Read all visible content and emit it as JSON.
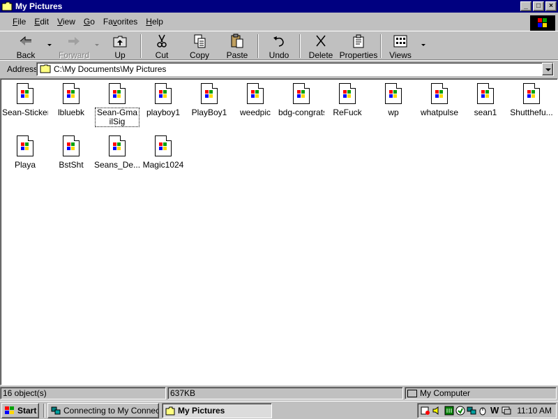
{
  "window": {
    "title": "My Pictures",
    "controls": {
      "minimize": "_",
      "maximize": "□",
      "close": "×"
    }
  },
  "menu": {
    "items": [
      {
        "key": "F",
        "rest": "ile"
      },
      {
        "key": "E",
        "rest": "dit"
      },
      {
        "key": "V",
        "rest": "iew"
      },
      {
        "key": "G",
        "rest": "o"
      },
      {
        "key": "",
        "rest": "Fa",
        "key2": "v",
        "rest2": "orites"
      },
      {
        "key": "H",
        "rest": "elp"
      }
    ]
  },
  "toolbar": {
    "back": "Back",
    "forward": "Forward",
    "up": "Up",
    "cut": "Cut",
    "copy": "Copy",
    "paste": "Paste",
    "undo": "Undo",
    "delete": "Delete",
    "properties": "Properties",
    "views": "Views"
  },
  "address": {
    "label": "Address",
    "value": "C:\\My Documents\\My Pictures"
  },
  "files": [
    {
      "name": "Sean-Sticker"
    },
    {
      "name": "lbluebk"
    },
    {
      "name": "Sean-GmailSig",
      "selected": true
    },
    {
      "name": "playboy1"
    },
    {
      "name": "PlayBoy1"
    },
    {
      "name": "weedpic"
    },
    {
      "name": "bdg-congrats"
    },
    {
      "name": "ReFuck"
    },
    {
      "name": "wp"
    },
    {
      "name": "whatpulse"
    },
    {
      "name": "sean1"
    },
    {
      "name": "Shutthefu..."
    },
    {
      "name": "Playa"
    },
    {
      "name": "BstSht"
    },
    {
      "name": "Seans_De..."
    },
    {
      "name": "Magic1024"
    }
  ],
  "status": {
    "objects": "16 object(s)",
    "size": "637KB",
    "zone": "My Computer"
  },
  "taskbar": {
    "start": "Start",
    "tasks": [
      {
        "label": "Connecting to My Connect..."
      },
      {
        "label": "My Pictures",
        "active": true
      }
    ],
    "clock": "11:10 AM"
  },
  "colors": {
    "titlebar": "#000080",
    "face": "#c0c0c0",
    "window_bg": "#ffffff",
    "flag_red": "#ff0000",
    "flag_green": "#00a000",
    "flag_blue": "#0000ff",
    "flag_yellow": "#ffd800"
  }
}
